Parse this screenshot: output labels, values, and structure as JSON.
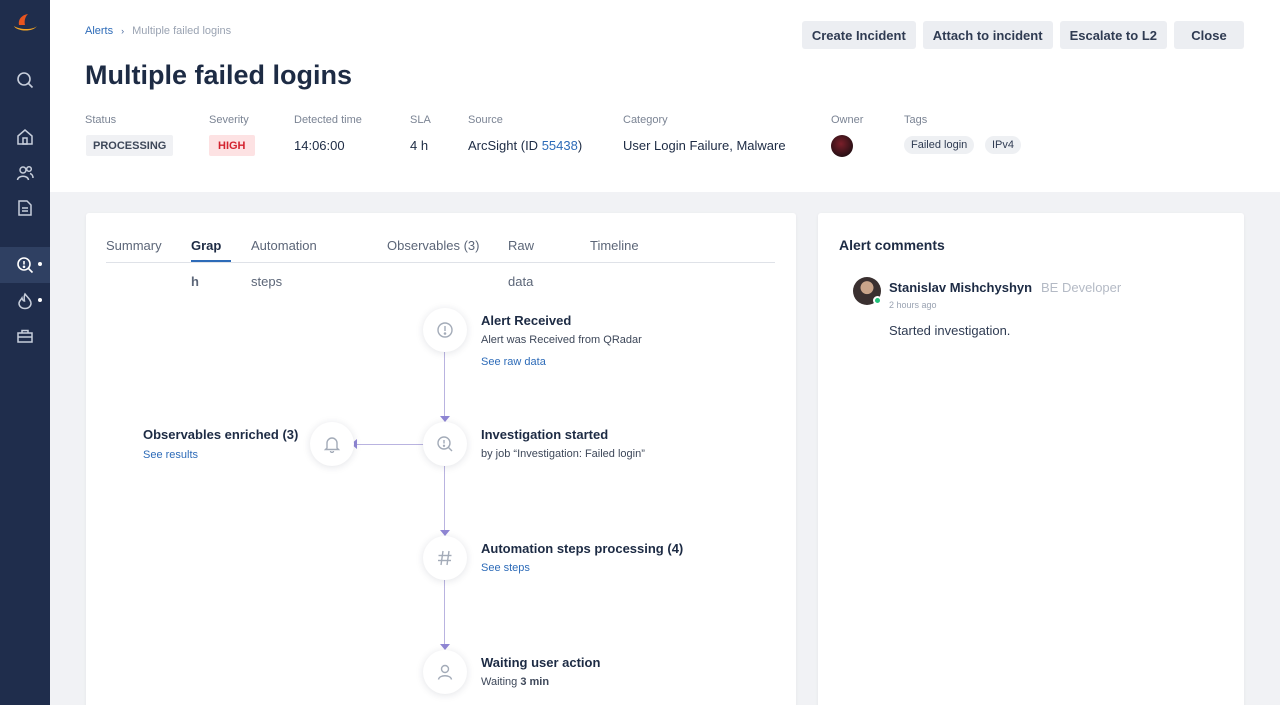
{
  "breadcrumb": {
    "parent": "Alerts",
    "separator": "›",
    "current": "Multiple failed logins"
  },
  "page_title": "Multiple failed logins",
  "actions": {
    "create_incident": "Create Incident",
    "attach_to_incident": "Attach to incident",
    "escalate": "Escalate to L2",
    "close": "Close"
  },
  "meta": {
    "status_label": "Status",
    "status_value": "PROCESSING",
    "severity_label": "Severity",
    "severity_value": "HIGH",
    "detected_label": "Detected time",
    "detected_value": "14:06:00",
    "sla_label": "SLA",
    "sla_value": "4 h",
    "source_label": "Source",
    "source_prefix": "ArcSight (ID ",
    "source_id": "55438",
    "source_suffix": ")",
    "category_label": "Category",
    "category_value": "User Login Failure, Malware",
    "owner_label": "Owner",
    "tags_label": "Tags",
    "tags": [
      "Failed login",
      "IPv4"
    ]
  },
  "tabs": {
    "summary": "Summary",
    "graph_1": "Grap",
    "graph_2": "h",
    "automation_1": "Automation",
    "automation_2": "steps",
    "observables": "Observables (3)",
    "raw_1": "Raw",
    "raw_2": "data",
    "timeline": "Timeline"
  },
  "graph": {
    "alert_received": {
      "title": "Alert Received",
      "subtitle": "Alert was Received from QRadar",
      "link": "See raw data"
    },
    "investigation": {
      "title": "Investigation started",
      "subtitle": "by job “Investigation: Failed login”"
    },
    "observables": {
      "title": "Observables enriched (3)",
      "link": "See results"
    },
    "automation": {
      "title": "Automation steps processing (4)",
      "link": "See steps"
    },
    "waiting": {
      "title": "Waiting user action",
      "subtitle_prefix": "Waiting ",
      "subtitle_value": "3 min"
    }
  },
  "comments": {
    "title": "Alert comments",
    "items": [
      {
        "author": "Stanislav Mishchyshyn",
        "role": "BE Developer",
        "time": "2 hours ago",
        "text": "Started investigation."
      }
    ]
  },
  "colors": {
    "sidebar": "#1f2d4c",
    "accent": "#2d6bb8",
    "high": "#d3232f",
    "graph_line": "#b9b3e0",
    "online": "#21c17b"
  },
  "icons": {
    "sidebar": [
      "logo",
      "search-icon",
      "home-icon",
      "users-icon",
      "document-icon",
      "alert-search-icon",
      "fire-icon",
      "briefcase-icon"
    ],
    "graph": [
      "info-icon",
      "investigation-icon",
      "bell-icon",
      "hash-icon",
      "user-icon"
    ]
  }
}
